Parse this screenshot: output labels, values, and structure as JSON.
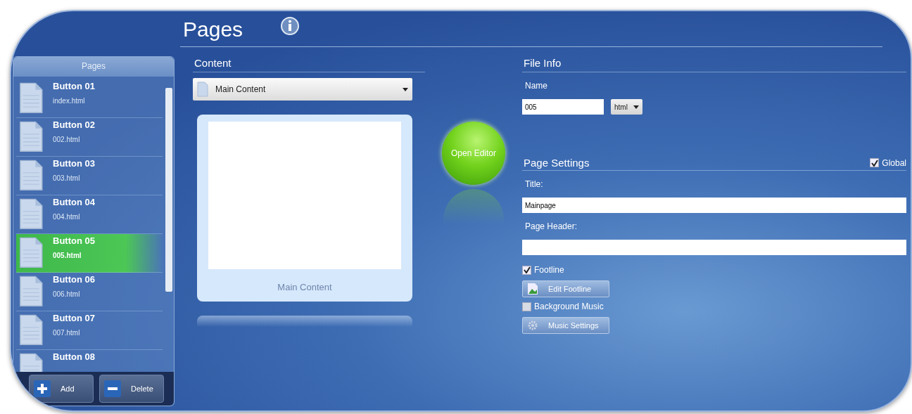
{
  "header": {
    "title": "Pages"
  },
  "sidebar": {
    "title": "Pages",
    "items": [
      {
        "title": "Button 01",
        "file": "index.html",
        "selected": false
      },
      {
        "title": "Button 02",
        "file": "002.html",
        "selected": false
      },
      {
        "title": "Button 03",
        "file": "003.html",
        "selected": false
      },
      {
        "title": "Button 04",
        "file": "004.html",
        "selected": false
      },
      {
        "title": "Button 05",
        "file": "005.html",
        "selected": true
      },
      {
        "title": "Button 06",
        "file": "006.html",
        "selected": false
      },
      {
        "title": "Button 07",
        "file": "007.html",
        "selected": false
      },
      {
        "title": "Button 08",
        "selected": false
      }
    ],
    "buttons": [
      {
        "kind": "add",
        "label": "Add"
      },
      {
        "kind": "delete",
        "label": "Delete"
      }
    ]
  },
  "content": {
    "heading": "Content",
    "dropdown": "Main Content",
    "preview_caption": "Main Content",
    "open_button": "Open Editor"
  },
  "file_info": {
    "heading": "File Info",
    "name_label": "Name",
    "name_value": "005",
    "extension": "html"
  },
  "page_settings": {
    "heading": "Page Settings",
    "global": {
      "label": "Global",
      "checked": true
    },
    "title_label": "Title:",
    "title_value": "Mainpage",
    "header_label": "Page Header:",
    "footline": {
      "label": "Footline",
      "checked": true
    },
    "edit_footline": "Edit Footline",
    "background_music": {
      "label": "Background Music",
      "checked": false
    },
    "music_settings": "Music Settings"
  }
}
